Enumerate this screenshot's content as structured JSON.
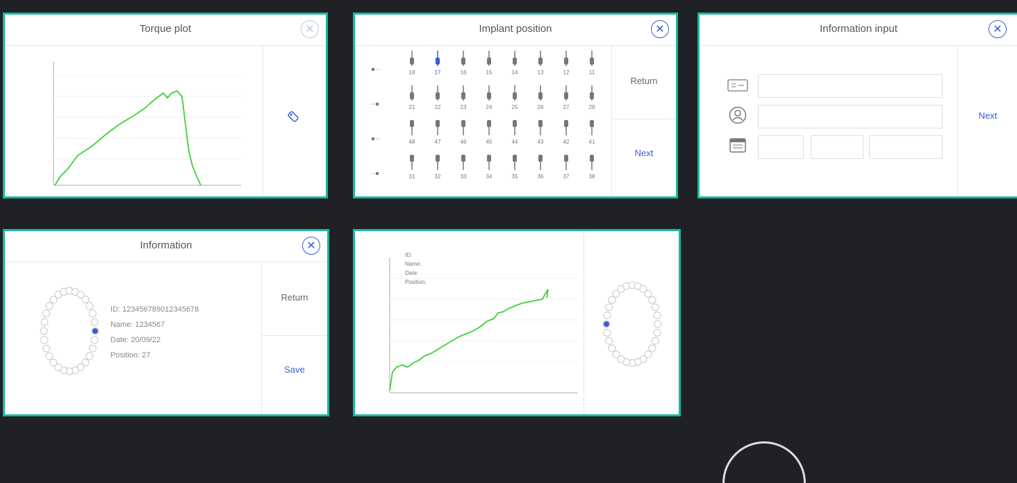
{
  "torque_panel": {
    "title": "Torque plot"
  },
  "implant_panel": {
    "title": "Implant position",
    "return_label": "Return",
    "next_label": "Next",
    "rows": [
      [
        "18",
        "17",
        "16",
        "15",
        "14",
        "13",
        "12",
        "11"
      ],
      [
        "21",
        "22",
        "23",
        "24",
        "25",
        "26",
        "27",
        "28"
      ],
      [
        "48",
        "47",
        "46",
        "45",
        "44",
        "43",
        "42",
        "41"
      ],
      [
        "31",
        "32",
        "33",
        "34",
        "35",
        "36",
        "37",
        "38"
      ]
    ],
    "selected": "17",
    "selected_color": "#3b5bd6"
  },
  "info_input_panel": {
    "title": "Information input",
    "next_label": "Next"
  },
  "information_panel": {
    "title": "Information",
    "return_label": "Return",
    "save_label": "Save",
    "id_line": "ID: 12345678901234567​8",
    "name_line": "Name: 1234567",
    "date_line": "Date: 20/09/22",
    "position_line": "Position: 27"
  },
  "chart_panel": {
    "legend_lines": [
      "ID:",
      "Name:",
      "Date:",
      "Position:"
    ]
  },
  "colors": {
    "accent": "#17b9a3",
    "blue": "#3b5bd6",
    "line": "#3ad13a",
    "background": "#1f2124"
  }
}
